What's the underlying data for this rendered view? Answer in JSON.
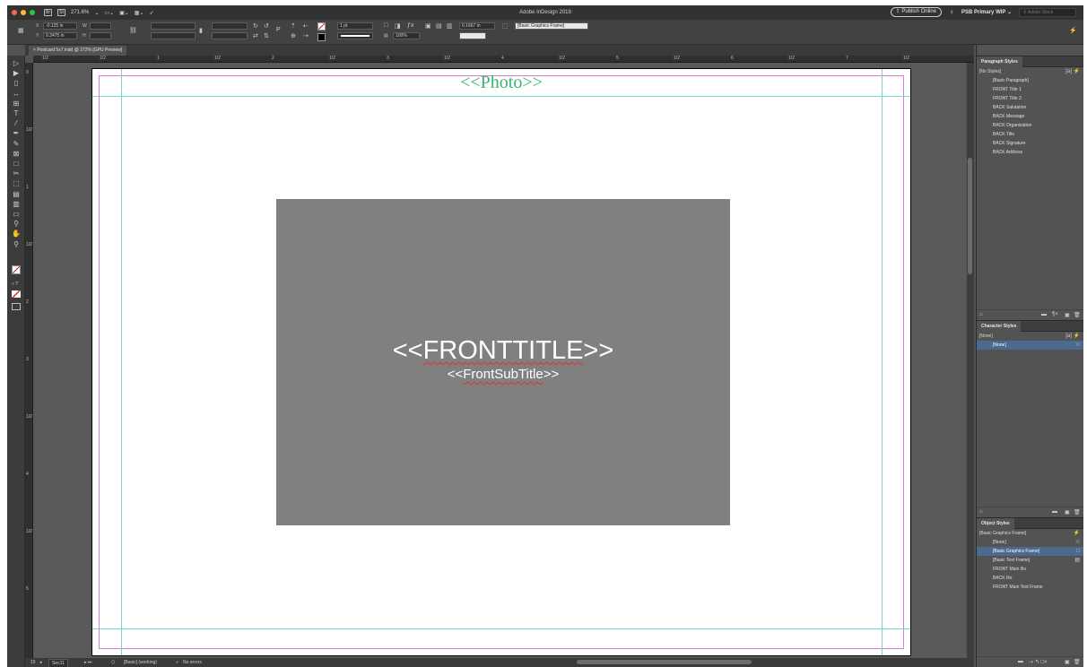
{
  "window": {
    "title": "Adobe InDesign 2019",
    "zoom": "271.6%",
    "publish_label": "Publish Online",
    "workspace": "PSB Primary WIP",
    "stock_placeholder": "Adobe Stock",
    "colors": {
      "traffic_red": "#ff5f57",
      "traffic_yellow": "#febc2e",
      "traffic_green": "#28c840"
    }
  },
  "control": {
    "x": "-0.125 in",
    "y": "0.3475 in",
    "stroke_weight": "1 pt",
    "opacity": "100%",
    "gap": "0.1667 in",
    "object_style": "[Basic Graphics Frame]"
  },
  "document": {
    "tab_label": "Postcard 5x7.indd @ 272% [GPU Preview]",
    "photo_label": "<<Photo>>",
    "front_title": "<<FRONTTITLE>>",
    "front_subtitle": "<<FrontSubTitle>>",
    "colors": {
      "photo_label": "#3cb371",
      "graphic_frame": "#808080",
      "guide": "#6fd6d6",
      "margin": "#d77fd6"
    }
  },
  "ruler": {
    "h_ticks": [
      "1/2",
      "1/2",
      "1",
      "1/2",
      "2",
      "1/2",
      "3",
      "1/2",
      "4",
      "1/2",
      "5",
      "1/2",
      "6",
      "1/2",
      "7",
      "1/2"
    ],
    "v_ticks": [
      "0",
      "1/2",
      "1",
      "1/2",
      "2",
      "3",
      "1/2",
      "4",
      "1/2",
      "5"
    ]
  },
  "status": {
    "page": "15",
    "section": "Sec11",
    "preflight_profile": "[Basic] (working)",
    "errors": "No errors"
  },
  "panels": {
    "paragraph": {
      "title": "Paragraph Styles",
      "current": "[No Styles]",
      "items": [
        "[Basic Paragraph]",
        "FRONT Title 1",
        "FRONT Title 2",
        "BACK Salutation",
        "BACK Message",
        "BACK Organization",
        "BACK Title",
        "BACK Signature",
        "BACK Address"
      ]
    },
    "character": {
      "title": "Character Styles",
      "current": "[None]",
      "items": [
        "[None]"
      ],
      "selected": 0
    },
    "object": {
      "title": "Object Styles",
      "current": "[Basic Graphics Frame]",
      "items": [
        "[None]",
        "[Basic Graphics Frame]",
        "[Basic Text Frame]",
        "FRONT Main Illo",
        "BACK Illo",
        "FRONT Main Text Frame"
      ],
      "selected": 1
    }
  },
  "tools": [
    {
      "name": "selection-tool-icon",
      "glyph": "▷"
    },
    {
      "name": "direct-selection-tool-icon",
      "glyph": "▶"
    },
    {
      "name": "page-tool-icon",
      "glyph": "▯"
    },
    {
      "name": "gap-tool-icon",
      "glyph": "↔"
    },
    {
      "name": "content-collector-icon",
      "glyph": "⊞"
    },
    {
      "name": "type-tool-icon",
      "glyph": "T"
    },
    {
      "name": "line-tool-icon",
      "glyph": "⁄"
    },
    {
      "name": "pen-tool-icon",
      "glyph": "✒"
    },
    {
      "name": "pencil-tool-icon",
      "glyph": "✎"
    },
    {
      "name": "rectangle-frame-tool-icon",
      "glyph": "⊠"
    },
    {
      "name": "rectangle-tool-icon",
      "glyph": "□"
    },
    {
      "name": "scissors-tool-icon",
      "glyph": "✂"
    },
    {
      "name": "free-transform-tool-icon",
      "glyph": "⬚"
    },
    {
      "name": "gradient-swatch-tool-icon",
      "glyph": "▤"
    },
    {
      "name": "gradient-feather-tool-icon",
      "glyph": "▥"
    },
    {
      "name": "note-tool-icon",
      "glyph": "▭"
    },
    {
      "name": "eyedropper-tool-icon",
      "glyph": "⚲"
    },
    {
      "name": "hand-tool-icon",
      "glyph": "✋"
    },
    {
      "name": "zoom-tool-icon",
      "glyph": "⚲"
    }
  ]
}
